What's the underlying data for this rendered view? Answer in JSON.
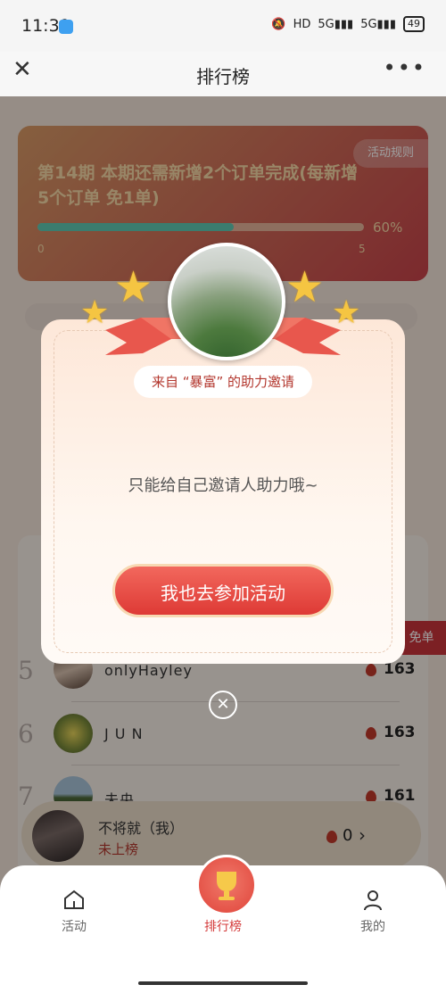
{
  "status_bar": {
    "time": "11:39",
    "battery": "49"
  },
  "title_bar": {
    "title": "排行榜"
  },
  "banner": {
    "headline": "第14期 本期还需新增2个订单完成(每新增5个订单 免1单)",
    "rules_label": "活动规则",
    "progress_percent": "60%",
    "progress_value": 0.6,
    "progress_min": "0",
    "progress_max": "5"
  },
  "side_tag": "免单",
  "leaderboard": {
    "rows": [
      {
        "rank": "5",
        "name": "onlyHayley",
        "score": "163"
      },
      {
        "rank": "6",
        "name": "J U N",
        "score": "163"
      },
      {
        "rank": "7",
        "name": "未央",
        "score": "161"
      }
    ]
  },
  "me": {
    "name": "不将就（我）",
    "status": "未上榜",
    "score": "0"
  },
  "modal": {
    "invite_label": "来自 “暴富” 的助力邀请",
    "message": "只能给自己邀请人助力哦~",
    "cta_label": "我也去参加活动"
  },
  "tabs": [
    {
      "label": "活动",
      "icon": "home-icon"
    },
    {
      "label": "排行榜",
      "icon": "trophy-icon"
    },
    {
      "label": "我的",
      "icon": "user-icon"
    }
  ],
  "colors": {
    "accent": "#d43a3a",
    "cta": "#e2453c",
    "progress": "#5fc9b2"
  }
}
